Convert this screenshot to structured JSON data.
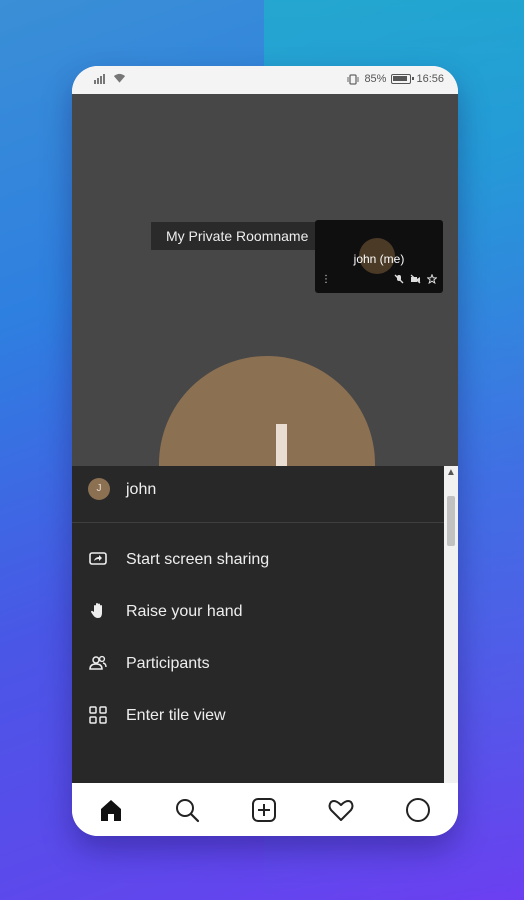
{
  "status_bar": {
    "battery_percent": "85%",
    "time": "16:56"
  },
  "stage": {
    "room_name": "My Private Roomname",
    "thumbnail": {
      "name": "john (me)"
    }
  },
  "sheet": {
    "user": {
      "initial": "J",
      "name": "john"
    },
    "items": [
      {
        "icon": "screen-share-icon",
        "label": "Start screen sharing"
      },
      {
        "icon": "raise-hand-icon",
        "label": "Raise your hand"
      },
      {
        "icon": "participants-icon",
        "label": "Participants"
      },
      {
        "icon": "tile-view-icon",
        "label": "Enter tile view"
      }
    ]
  },
  "nav": {
    "items": [
      "home-icon",
      "search-icon",
      "add-icon",
      "heart-icon",
      "profile-icon"
    ]
  },
  "colors": {
    "sheet_bg": "#282828",
    "stage_bg": "#474747",
    "avatar": "#8c7052"
  }
}
